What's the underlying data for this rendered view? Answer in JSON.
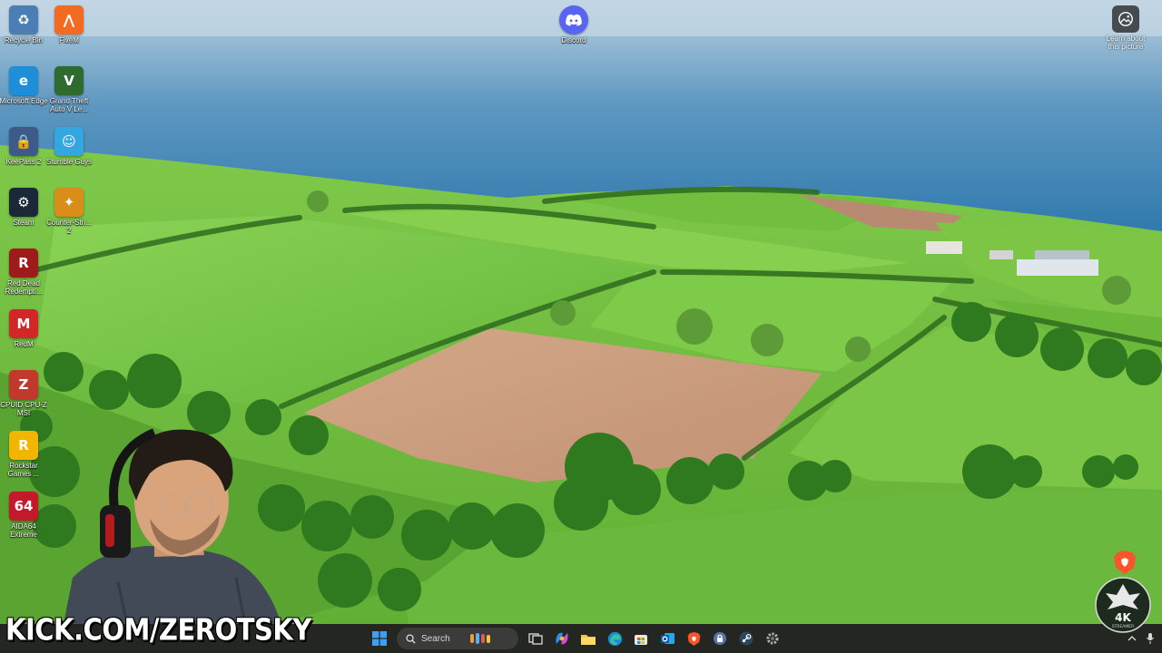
{
  "desktop": {
    "icons": [
      {
        "label": "Recycle Bin",
        "icon": "recycle-bin-icon",
        "color": "#4a7fb5"
      },
      {
        "label": "FiveM",
        "icon": "fivem-icon",
        "color": "#f26b21"
      },
      {
        "label": "Microsoft Edge",
        "icon": "edge-icon",
        "color": "#1d8fd8"
      },
      {
        "label": "Grand Theft Auto V Le...",
        "icon": "gta5-icon",
        "color": "#2f6b2f"
      },
      {
        "label": "KeePass 2",
        "icon": "keepass-icon",
        "color": "#3e5a8a"
      },
      {
        "label": "Stumble Guys",
        "icon": "stumble-guys-icon",
        "color": "#35a7e0"
      },
      {
        "label": "Steam",
        "icon": "steam-icon",
        "color": "#1b2838"
      },
      {
        "label": "Counter-Stri... 2",
        "icon": "cs2-icon",
        "color": "#d98e1a"
      },
      {
        "label": "Red Dead Redempti...",
        "icon": "rdr2-icon",
        "color": "#9e1b1b"
      },
      {
        "label": "RedM",
        "icon": "redm-icon",
        "color": "#d32626"
      },
      {
        "label": "CPUID CPU-Z MSI",
        "icon": "cpuz-icon",
        "color": "#c0392b"
      },
      {
        "label": "Rockstar Games ...",
        "icon": "rockstar-icon",
        "color": "#f2b600"
      },
      {
        "label": "AIDA64 Extreme",
        "icon": "aida64-icon",
        "color": "#c4182b"
      }
    ],
    "discord": {
      "label": "Discord",
      "color": "#5865f2"
    },
    "learn": {
      "label": "Learn about this picture"
    },
    "brave": {
      "color": "#fb542b"
    }
  },
  "overlay": {
    "kick_text": "KICK.COM/ZEROTSKY",
    "kick_color": "#53fc18",
    "badge_text": "4K",
    "badge_sub": "STREAMER"
  },
  "taskbar": {
    "search_label": "Search",
    "pinned": [
      "start-icon",
      "search",
      "widgets-icon",
      "task-view-icon",
      "copilot-icon",
      "file-explorer-icon",
      "edge-icon",
      "store-icon",
      "outlook-icon",
      "brave-icon",
      "keepass-icon",
      "steam-icon",
      "settings-icon"
    ],
    "tray": [
      "chevron-up-icon",
      "mic-icon"
    ]
  }
}
